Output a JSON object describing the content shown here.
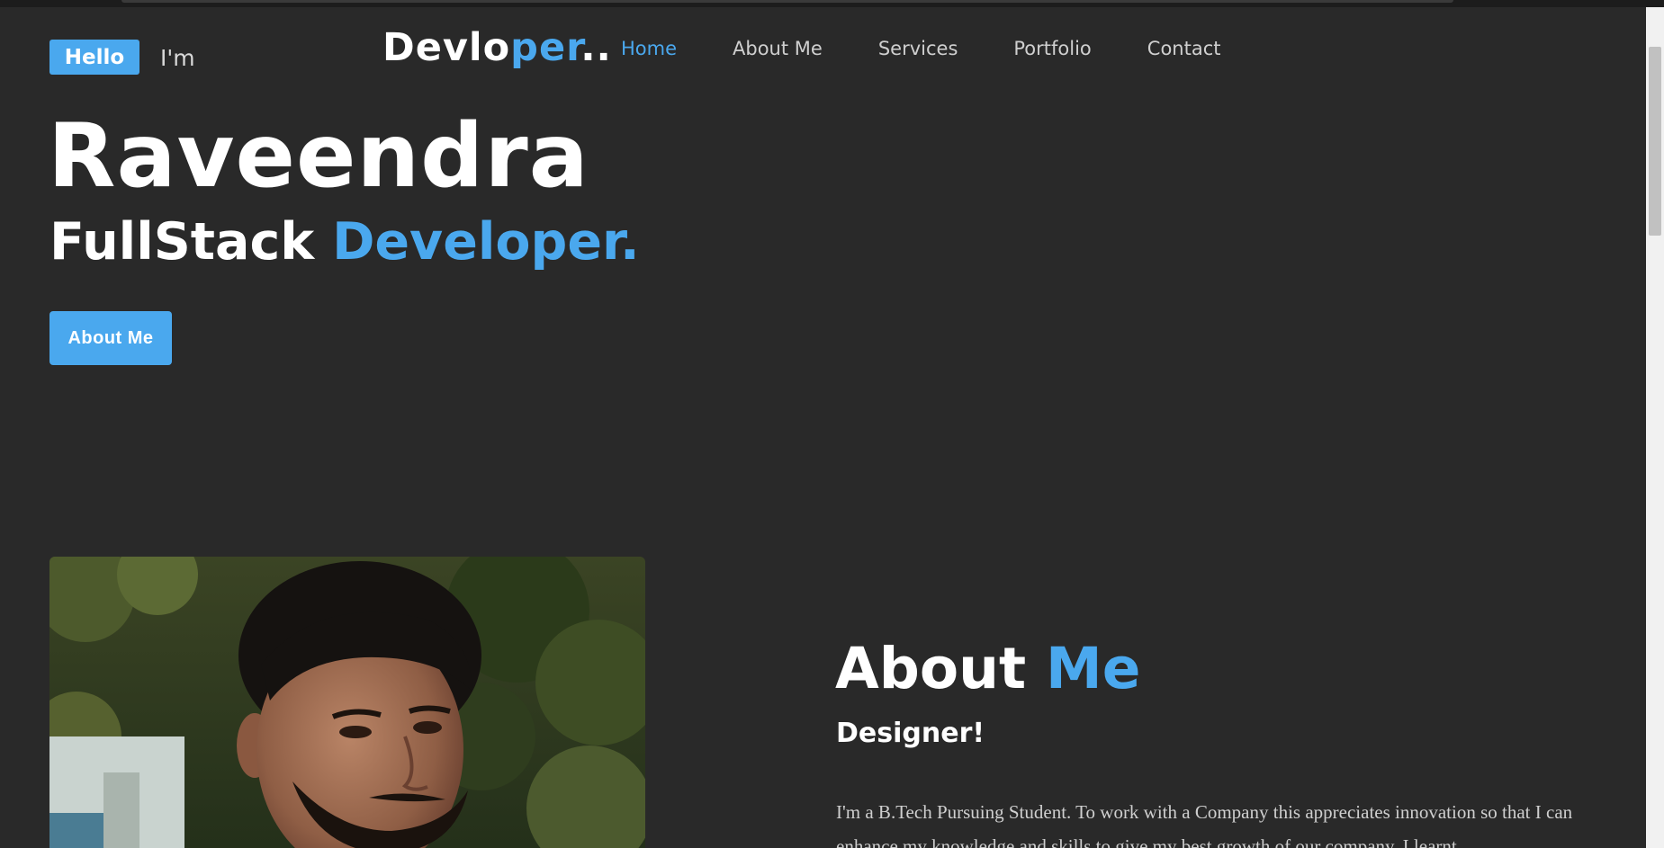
{
  "header": {
    "hello_badge": "Hello",
    "im_text": "I'm",
    "brand_part1": "Devlo",
    "brand_part2": "per",
    "brand_part3": "..",
    "nav": [
      "Home",
      "About Me",
      "Services",
      "Portfolio",
      "Contact"
    ],
    "active_nav": "Home"
  },
  "hero": {
    "name": "Raveendra",
    "role_part1": "FullStack ",
    "role_part2": "Developer.",
    "button_label": "About Me"
  },
  "about": {
    "title_part1": "About ",
    "title_part2": "Me",
    "subtitle": "Designer!",
    "paragraph": "I'm a B.Tech Pursuing Student. To work with a Company this appreciates innovation so that I can enhance my knowledge and skills to give my best growth of our company. I learnt"
  },
  "photo": {
    "icon": "profile-photo"
  },
  "colors": {
    "background": "#292929",
    "accent": "#4aa8ee",
    "text": "#ffffff",
    "muted_text": "#cfcfcf"
  }
}
